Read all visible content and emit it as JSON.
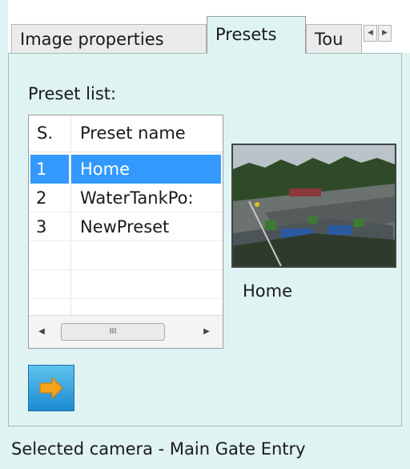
{
  "tabs": [
    {
      "label": "Image properties",
      "active": false
    },
    {
      "label": "Presets",
      "active": true
    },
    {
      "label": "Tou",
      "active": false
    }
  ],
  "tab_scroll": {
    "left_icon": "arrow-left-icon",
    "right_icon": "arrow-right-icon"
  },
  "preset_list": {
    "label": "Preset list:",
    "columns": [
      "S.",
      "Preset name"
    ],
    "rows": [
      {
        "num": "1",
        "name": "Home",
        "selected": true
      },
      {
        "num": "2",
        "name": "WaterTankPo:",
        "selected": false
      },
      {
        "num": "3",
        "name": "NewPreset",
        "selected": false
      }
    ],
    "scroll_thumb_glyph": "III"
  },
  "preview": {
    "caption": "Home",
    "image": "camera-preview-thumbnail"
  },
  "go_button": {
    "icon": "arrow-right-icon",
    "color": "#3aa9e4"
  },
  "status": {
    "text": "Selected camera - Main Gate Entry"
  },
  "colors": {
    "panel_bg": "#dff3f3",
    "selection": "#3399ff"
  }
}
